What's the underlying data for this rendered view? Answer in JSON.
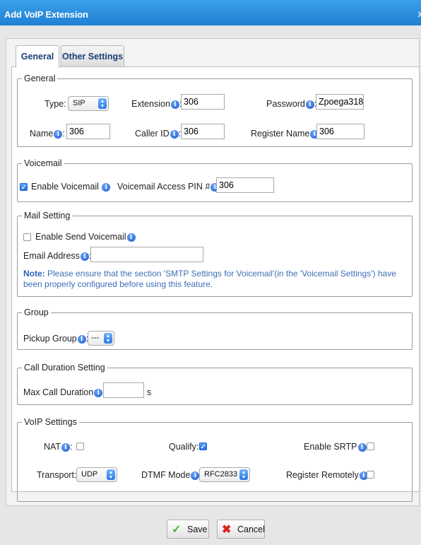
{
  "window": {
    "title": "Add VoIP Extension",
    "close_glyph": "x"
  },
  "tabs": [
    {
      "label": "General",
      "active": true
    },
    {
      "label": "Other Settings",
      "active": false
    }
  ],
  "info_glyph": "i",
  "general": {
    "legend": "General",
    "type_label": "Type:",
    "type_value": "SIP",
    "extension_label": "Extension",
    "extension_value": "306",
    "password_label": "Password",
    "password_value": "Zpoega318",
    "name_label": "Name",
    "name_value": "306",
    "caller_id_label": "Caller ID",
    "caller_id_value": "306",
    "register_name_label": "Register Name",
    "register_name_value": "306"
  },
  "voicemail": {
    "legend": "Voicemail",
    "enable_label": "Enable Voicemail",
    "enable_checked": true,
    "pin_label": "Voicemail Access PIN #",
    "pin_value": "306"
  },
  "mail": {
    "legend": "Mail Setting",
    "enable_send_label": "Enable Send Voicemail",
    "enable_send_checked": false,
    "email_label": "Email Address",
    "email_value": "",
    "note_prefix": "Note:",
    "note_line1": " Please ensure that the section 'SMTP Settings for Voicemail'(in the 'Voicemail Settings') have",
    "note_line2": "been properly configured before using this feature."
  },
  "group": {
    "legend": "Group",
    "pickup_label": "Pickup Group",
    "pickup_value": "---"
  },
  "call_duration": {
    "legend": "Call Duration Setting",
    "max_label": "Max Call Duration",
    "max_value": "",
    "unit": "s"
  },
  "voip": {
    "legend": "VoIP Settings",
    "nat_label": "NAT",
    "nat_checked": false,
    "qualify_label": "Qualify:",
    "qualify_checked": true,
    "srtp_label": "Enable SRTP",
    "srtp_checked": false,
    "transport_label": "Transport:",
    "transport_value": "UDP",
    "dtmf_label": "DTMF Mode",
    "dtmf_value": "RFC2833",
    "register_remotely_label": "Register Remotely",
    "register_remotely_checked": false
  },
  "buttons": {
    "save_label": "Save",
    "cancel_label": "Cancel"
  },
  "colors": {
    "title_bar": "#2a8fe0",
    "accent": "#1f6fe0",
    "note_text": "#3d6fb6",
    "save_icon": "#48b53a",
    "cancel_icon": "#d9261c"
  },
  "icons": [
    "info-icon",
    "checkmark-icon",
    "cross-icon",
    "select-arrow-icon"
  ]
}
